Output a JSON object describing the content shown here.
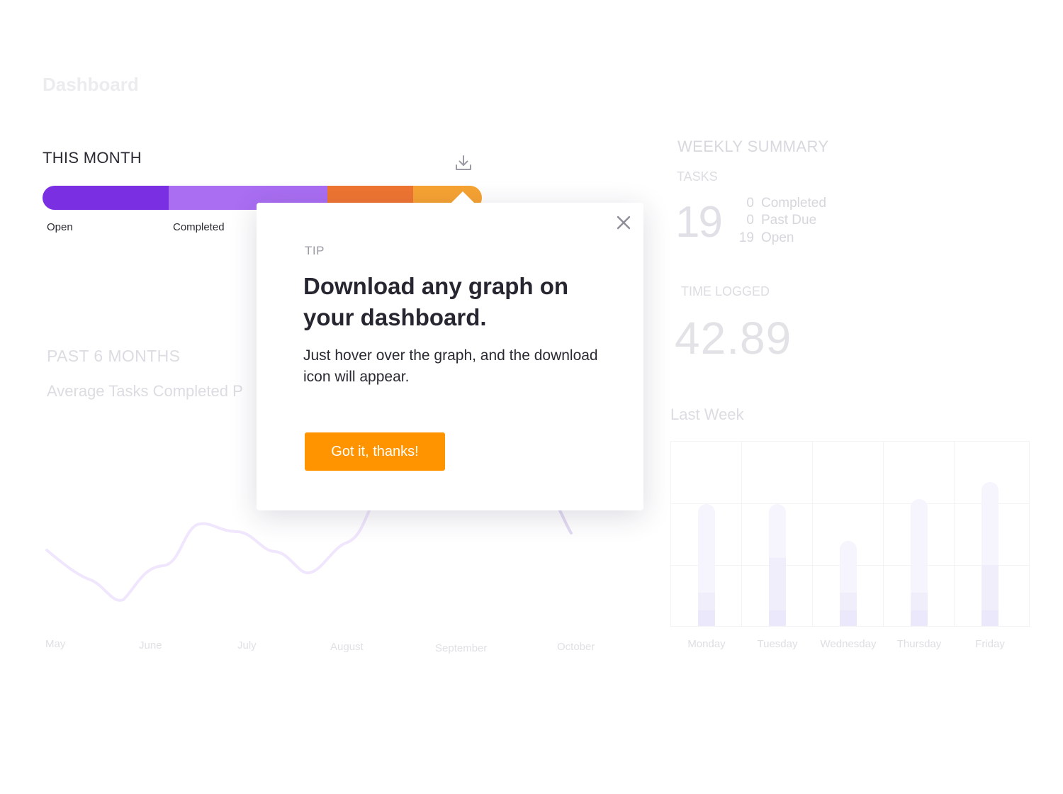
{
  "page": {
    "title": "Dashboard"
  },
  "this_month": {
    "title": "THIS MONTH",
    "download_icon": "download-icon",
    "segments": [
      {
        "label": "Open",
        "value": 0.287,
        "color": "#7b2fe2"
      },
      {
        "label": "Completed",
        "value": 0.361,
        "color": "#a96ef2"
      },
      {
        "label": "",
        "value": 0.195,
        "color": "#ef7531"
      },
      {
        "label": "",
        "value": 0.157,
        "color": "#f6a332"
      }
    ]
  },
  "past_6_months": {
    "title": "PAST 6 MONTHS",
    "subtitle": "Average Tasks Completed P",
    "months": [
      "May",
      "June",
      "July",
      "August",
      "September",
      "October"
    ]
  },
  "weekly_summary": {
    "title": "WEEKLY SUMMARY",
    "tasks_label": "TASKS",
    "tasks_total": "19",
    "task_rows": [
      {
        "count": "0",
        "label": "Completed"
      },
      {
        "count": "0",
        "label": "Past Due"
      },
      {
        "count": "19",
        "label": "Open"
      }
    ],
    "time_logged_label": "TIME LOGGED",
    "time_logged_value": "42.89",
    "last_week_title": "Last Week",
    "days": [
      {
        "label": "Monday",
        "total": 0.66,
        "mid": 0.18
      },
      {
        "label": "Tuesday",
        "total": 0.66,
        "mid": 0.37
      },
      {
        "label": "Wednesday",
        "total": 0.46,
        "mid": 0.18
      },
      {
        "label": "Thursday",
        "total": 0.69,
        "mid": 0.18
      },
      {
        "label": "Friday",
        "total": 0.78,
        "mid": 0.33
      }
    ]
  },
  "tip_popup": {
    "tag": "TIP",
    "heading": "Download any graph on your dashboard.",
    "body": "Just hover over the graph, and the download icon will appear.",
    "button_label": "Got it, thanks!",
    "close_icon": "close-icon",
    "button_color": "#ff9400"
  }
}
